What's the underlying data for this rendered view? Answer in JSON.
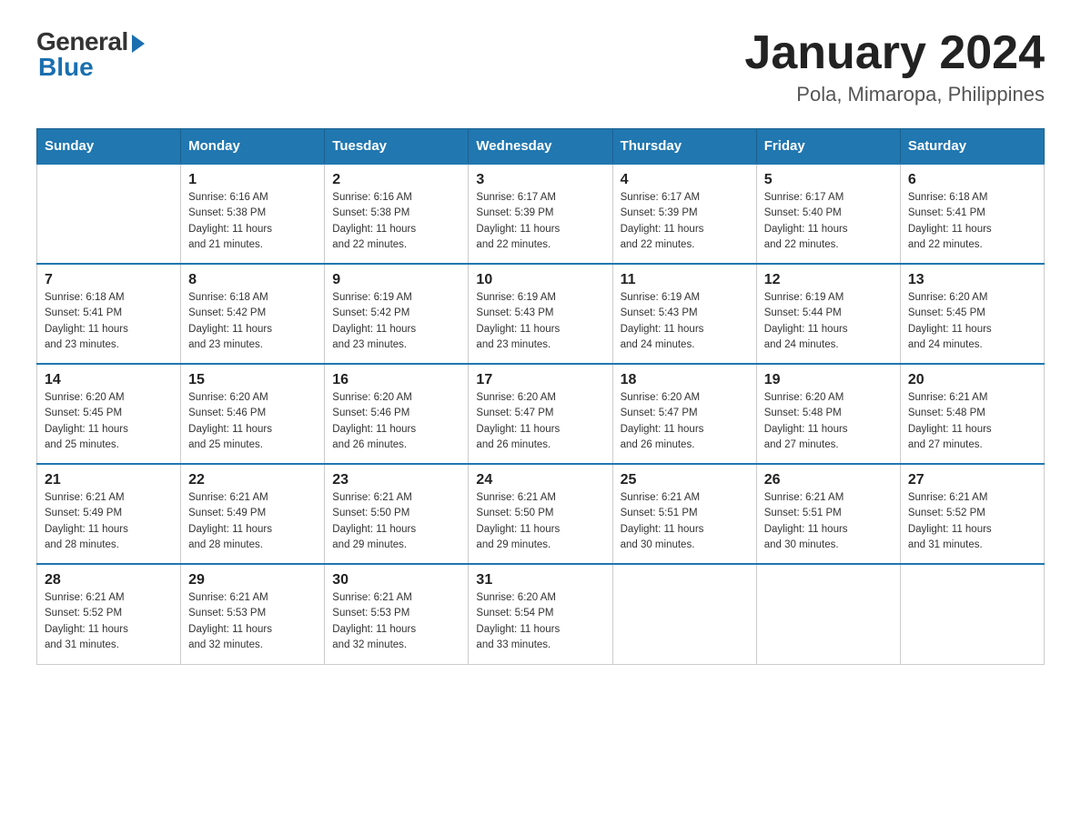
{
  "logo": {
    "general": "General",
    "blue": "Blue"
  },
  "header": {
    "month_year": "January 2024",
    "location": "Pola, Mimaropa, Philippines"
  },
  "weekdays": [
    "Sunday",
    "Monday",
    "Tuesday",
    "Wednesday",
    "Thursday",
    "Friday",
    "Saturday"
  ],
  "weeks": [
    [
      {
        "day": "",
        "info": ""
      },
      {
        "day": "1",
        "info": "Sunrise: 6:16 AM\nSunset: 5:38 PM\nDaylight: 11 hours\nand 21 minutes."
      },
      {
        "day": "2",
        "info": "Sunrise: 6:16 AM\nSunset: 5:38 PM\nDaylight: 11 hours\nand 22 minutes."
      },
      {
        "day": "3",
        "info": "Sunrise: 6:17 AM\nSunset: 5:39 PM\nDaylight: 11 hours\nand 22 minutes."
      },
      {
        "day": "4",
        "info": "Sunrise: 6:17 AM\nSunset: 5:39 PM\nDaylight: 11 hours\nand 22 minutes."
      },
      {
        "day": "5",
        "info": "Sunrise: 6:17 AM\nSunset: 5:40 PM\nDaylight: 11 hours\nand 22 minutes."
      },
      {
        "day": "6",
        "info": "Sunrise: 6:18 AM\nSunset: 5:41 PM\nDaylight: 11 hours\nand 22 minutes."
      }
    ],
    [
      {
        "day": "7",
        "info": "Sunrise: 6:18 AM\nSunset: 5:41 PM\nDaylight: 11 hours\nand 23 minutes."
      },
      {
        "day": "8",
        "info": "Sunrise: 6:18 AM\nSunset: 5:42 PM\nDaylight: 11 hours\nand 23 minutes."
      },
      {
        "day": "9",
        "info": "Sunrise: 6:19 AM\nSunset: 5:42 PM\nDaylight: 11 hours\nand 23 minutes."
      },
      {
        "day": "10",
        "info": "Sunrise: 6:19 AM\nSunset: 5:43 PM\nDaylight: 11 hours\nand 23 minutes."
      },
      {
        "day": "11",
        "info": "Sunrise: 6:19 AM\nSunset: 5:43 PM\nDaylight: 11 hours\nand 24 minutes."
      },
      {
        "day": "12",
        "info": "Sunrise: 6:19 AM\nSunset: 5:44 PM\nDaylight: 11 hours\nand 24 minutes."
      },
      {
        "day": "13",
        "info": "Sunrise: 6:20 AM\nSunset: 5:45 PM\nDaylight: 11 hours\nand 24 minutes."
      }
    ],
    [
      {
        "day": "14",
        "info": "Sunrise: 6:20 AM\nSunset: 5:45 PM\nDaylight: 11 hours\nand 25 minutes."
      },
      {
        "day": "15",
        "info": "Sunrise: 6:20 AM\nSunset: 5:46 PM\nDaylight: 11 hours\nand 25 minutes."
      },
      {
        "day": "16",
        "info": "Sunrise: 6:20 AM\nSunset: 5:46 PM\nDaylight: 11 hours\nand 26 minutes."
      },
      {
        "day": "17",
        "info": "Sunrise: 6:20 AM\nSunset: 5:47 PM\nDaylight: 11 hours\nand 26 minutes."
      },
      {
        "day": "18",
        "info": "Sunrise: 6:20 AM\nSunset: 5:47 PM\nDaylight: 11 hours\nand 26 minutes."
      },
      {
        "day": "19",
        "info": "Sunrise: 6:20 AM\nSunset: 5:48 PM\nDaylight: 11 hours\nand 27 minutes."
      },
      {
        "day": "20",
        "info": "Sunrise: 6:21 AM\nSunset: 5:48 PM\nDaylight: 11 hours\nand 27 minutes."
      }
    ],
    [
      {
        "day": "21",
        "info": "Sunrise: 6:21 AM\nSunset: 5:49 PM\nDaylight: 11 hours\nand 28 minutes."
      },
      {
        "day": "22",
        "info": "Sunrise: 6:21 AM\nSunset: 5:49 PM\nDaylight: 11 hours\nand 28 minutes."
      },
      {
        "day": "23",
        "info": "Sunrise: 6:21 AM\nSunset: 5:50 PM\nDaylight: 11 hours\nand 29 minutes."
      },
      {
        "day": "24",
        "info": "Sunrise: 6:21 AM\nSunset: 5:50 PM\nDaylight: 11 hours\nand 29 minutes."
      },
      {
        "day": "25",
        "info": "Sunrise: 6:21 AM\nSunset: 5:51 PM\nDaylight: 11 hours\nand 30 minutes."
      },
      {
        "day": "26",
        "info": "Sunrise: 6:21 AM\nSunset: 5:51 PM\nDaylight: 11 hours\nand 30 minutes."
      },
      {
        "day": "27",
        "info": "Sunrise: 6:21 AM\nSunset: 5:52 PM\nDaylight: 11 hours\nand 31 minutes."
      }
    ],
    [
      {
        "day": "28",
        "info": "Sunrise: 6:21 AM\nSunset: 5:52 PM\nDaylight: 11 hours\nand 31 minutes."
      },
      {
        "day": "29",
        "info": "Sunrise: 6:21 AM\nSunset: 5:53 PM\nDaylight: 11 hours\nand 32 minutes."
      },
      {
        "day": "30",
        "info": "Sunrise: 6:21 AM\nSunset: 5:53 PM\nDaylight: 11 hours\nand 32 minutes."
      },
      {
        "day": "31",
        "info": "Sunrise: 6:20 AM\nSunset: 5:54 PM\nDaylight: 11 hours\nand 33 minutes."
      },
      {
        "day": "",
        "info": ""
      },
      {
        "day": "",
        "info": ""
      },
      {
        "day": "",
        "info": ""
      }
    ]
  ]
}
